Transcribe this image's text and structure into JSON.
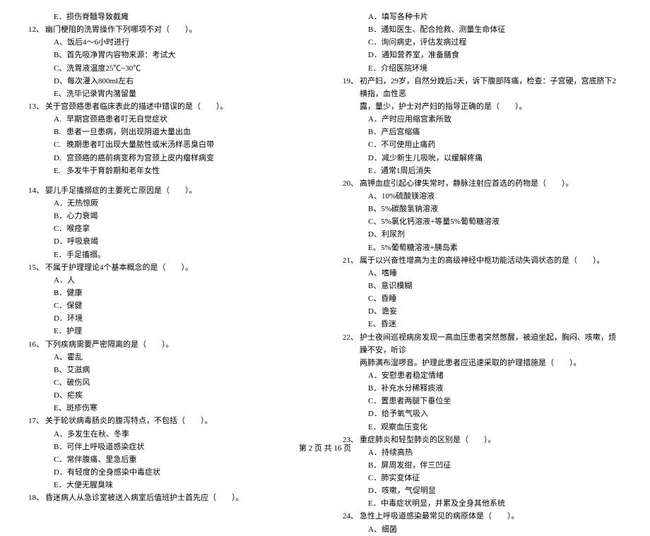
{
  "left": {
    "q11_optE": "损伤脊髓导致截瘫",
    "q12": {
      "num": "12、",
      "text": "幽门梗阻的洗胃操作下列哪项不对（　　）。",
      "opts": [
        "饭后4～6小时进行",
        "首先吸净胃内容物来源：考试大",
        "洗胃液温度25℃~30℃",
        "每次灌入800ml左右",
        "洗毕记录胃内潴留量"
      ]
    },
    "q13": {
      "num": "13、",
      "text": "关于宫颈癌患者临床表此的描述中错误的是（　　）。",
      "opts": [
        "早期宫颈癌患者叮无自觉症状",
        "患者一旦患病，则出现阴道大量出血",
        "晚期患者叮出现大量脓性或米汤样恶臭白带",
        "宫颈癌的癌前病变称为宫颈上皮内瘤样病变",
        "多发牛于育龄期和老年女性"
      ]
    },
    "q14": {
      "num": "14、",
      "text": "婴儿手足搐搦症的主要死亡原因是（　　）。",
      "opts": [
        "无热惊厥",
        "心力衰竭",
        "喉痉挛",
        "呼吸衰竭",
        "手足搐搦。"
      ]
    },
    "q15": {
      "num": "15、",
      "text": "不属于护理理论4个基本概念的是（　　）。",
      "opts": [
        "人",
        "健康",
        "保健",
        "环境",
        "护理"
      ]
    },
    "q16": {
      "num": "16、",
      "text": "下列疾病需要严密隔离的是（　　）。",
      "opts": [
        "霍乱",
        "艾滋病",
        "破伤风",
        "疟疾",
        "斑疹伤寒"
      ]
    },
    "q17": {
      "num": "17、",
      "text": "关于轮状病毒肠炎的腹泻特点，不包括（　　）。",
      "opts": [
        "多发生在秋、冬季",
        "可伴上呼吸道感染症状",
        "常伴腹痛、里急后重",
        "有轻度的全身感染中毒症状",
        "大便无腥臭味"
      ]
    },
    "q18": {
      "num": "18、",
      "text": "昏迷病人从急诊室被送入病室后值班护士首先应（　　）。"
    }
  },
  "right": {
    "q18_opts": [
      "填写各种卡片",
      "通知医生、配合抢救、测量生命体征",
      "询问病史，评估发病过程",
      "通知营养室，准备膳食",
      "介绍医院环境"
    ],
    "q19": {
      "num": "19、",
      "text1": "初产妇，29岁，自然分娩后2天，诉下腹部阵痛，检查：子宫硬，宫底脐下2横指，血性恶",
      "text2": "露，量少，护士对产妇的指导正确的是（　　）。",
      "opts": [
        "产时应用缩宫素所致",
        "产后宫缩痛",
        "不可使用止痛药",
        "减少新生儿吸吮，以缓解疼痛",
        "通常1周后消失"
      ]
    },
    "q20": {
      "num": "20、",
      "text": "高钾血症引起心律失常时，静脉注射应首选的药物是（　　）。",
      "opts": [
        "10%硫酸镁溶液",
        "5%碳酸氢钠溶液",
        "5%氯化钙溶液+等量5%葡萄糖溶液",
        "利尿剂",
        "5%葡萄糖溶液+胰岛素"
      ]
    },
    "q21": {
      "num": "21、",
      "text": "属于以兴奋性增高为主的高级神经中枢功能活动失调状态的是（　　）。",
      "opts": [
        "嗜睡",
        "意识模糊",
        "昏睡",
        "谵妄",
        "昏迷"
      ]
    },
    "q22": {
      "num": "22、",
      "text1": "护士夜间巡视病房发现一高血压患者突然憋醒，被迫坐起，胸闷、咳嗽，烦躁不安，听诊",
      "text2": "两肺满布湿啰音。护理此患者应迅速采取的护理措施是（　　）。",
      "opts": [
        "安慰患者稳定情绪",
        "补充水分稀释痰液",
        "置患者两腿下垂位坐",
        "给予氧气吸入",
        "观察血压变化"
      ]
    },
    "q23": {
      "num": "23、",
      "text": "重症肺炎和轻型肺炎的区别是（　　）。",
      "opts": [
        "持续高热",
        "屏周发绀，伴三凹征",
        "肺实变体征",
        "咳嗽，气促明显",
        "中毒症状明显，并累及全身其他系统"
      ]
    },
    "q24": {
      "num": "24、",
      "text": "急性上呼吸道感染最常见的病原体是（　　）。",
      "opts": [
        "细菌"
      ]
    }
  },
  "footer": "第 2 页 共 16 页"
}
